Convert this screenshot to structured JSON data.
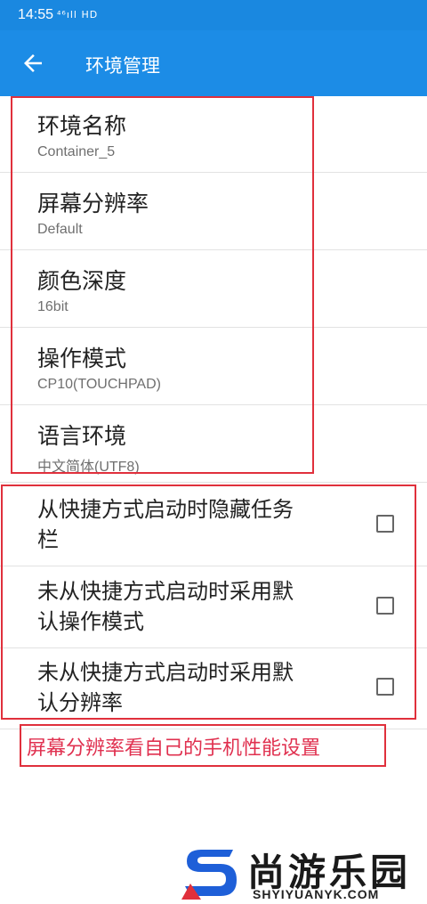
{
  "status_bar": {
    "time": "14:55",
    "icons": "⁴⁶ıll HD"
  },
  "app_bar": {
    "title": "环境管理"
  },
  "preferences": [
    {
      "title": "环境名称",
      "summary": "Container_5"
    },
    {
      "title": "屏幕分辨率",
      "summary": "Default"
    },
    {
      "title": "颜色深度",
      "summary": "16bit"
    },
    {
      "title": "操作模式",
      "summary": "CP10(TOUCHPAD)"
    },
    {
      "title": "语言环境",
      "summary": "中文简体(UTF8)"
    }
  ],
  "checkbox_items": [
    {
      "line1": "从快捷方式启动时隐藏任务",
      "line2": "栏",
      "checked": false
    },
    {
      "line1": "未从快捷方式启动时采用默",
      "line2": "认操作模式",
      "checked": false
    },
    {
      "line1": "未从快捷方式启动时采用默",
      "line2": "认分辨率",
      "checked": false
    }
  ],
  "annotation": {
    "text": "屏幕分辨率看自己的手机性能设置"
  },
  "watermark": {
    "name": "尚游乐园",
    "url": "SHYIYUANYK.COM"
  },
  "colors": {
    "app_bar": "#1c8ce6",
    "highlight_red": "#e0303c",
    "logo_blue": "#1e5fd8"
  }
}
